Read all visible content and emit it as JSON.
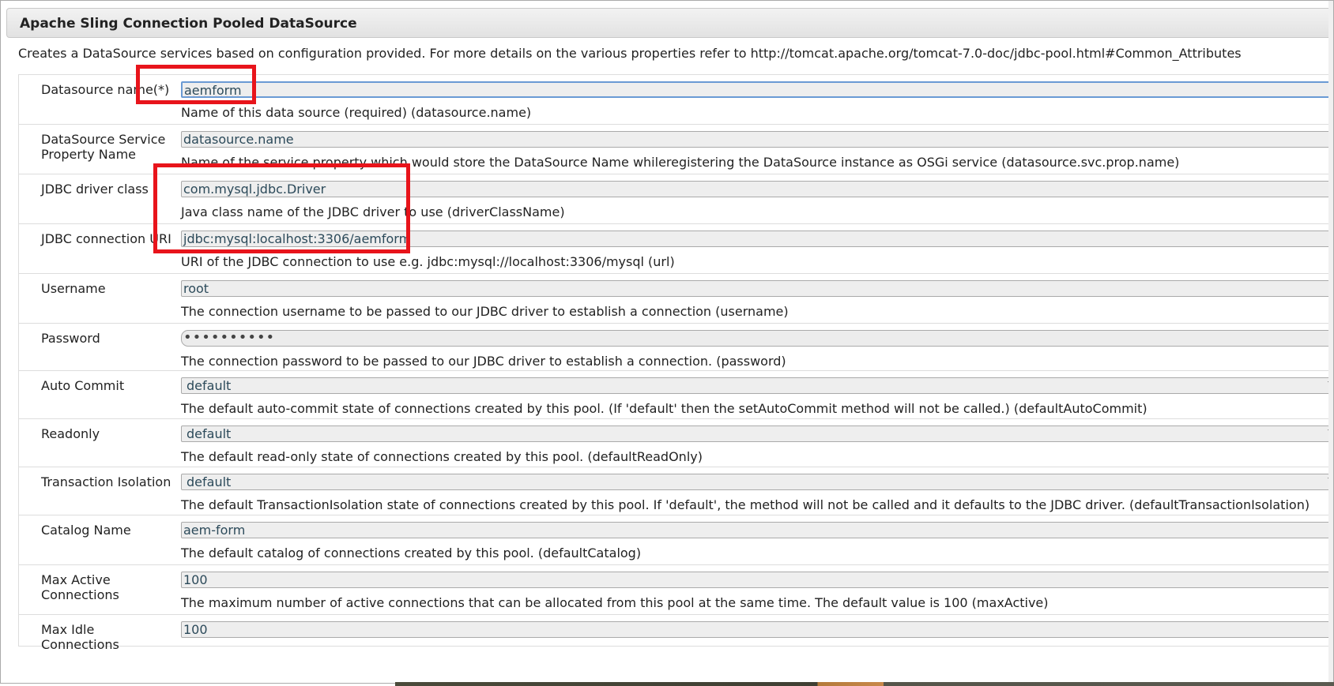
{
  "dialog": {
    "title": "Apache Sling Connection Pooled DataSource",
    "description": "Creates a DataSource services based on configuration provided. For more details on the various properties refer to http://tomcat.apache.org/tomcat-7.0-doc/jdbc-pool.html#Common_Attributes"
  },
  "fields": [
    {
      "label": "Datasource name(*)",
      "value": "aemform",
      "help": "Name of this data source (required) (datasource.name)",
      "type": "text",
      "focused": true
    },
    {
      "label": "DataSource Service Property Name",
      "value": "datasource.name",
      "help": "Name of the service property which would store the DataSource Name whileregistering the DataSource instance as OSGi service (datasource.svc.prop.name)",
      "type": "text"
    },
    {
      "label": "JDBC driver class",
      "value": "com.mysql.jdbc.Driver",
      "help": "Java class name of the JDBC driver to use (driverClassName)",
      "type": "text"
    },
    {
      "label": "JDBC connection URI",
      "value": "jdbc:mysql:localhost:3306/aemform",
      "help": "URI of the JDBC connection to use e.g. jdbc:mysql://localhost:3306/mysql (url)",
      "type": "text"
    },
    {
      "label": "Username",
      "value": "root",
      "help": "The connection username to be passed to our JDBC driver to establish a connection (username)",
      "type": "text"
    },
    {
      "label": "Password",
      "value": "••••••••••",
      "help": "The connection password to be passed to our JDBC driver to establish a connection. (password)",
      "type": "password"
    },
    {
      "label": "Auto Commit",
      "value": "default",
      "help": "The default auto-commit state of connections created by this pool. (If 'default' then the setAutoCommit method will not be called.) (defaultAutoCommit)",
      "type": "select"
    },
    {
      "label": "Readonly",
      "value": "default",
      "help": "The default read-only state of connections created by this pool. (defaultReadOnly)",
      "type": "select"
    },
    {
      "label": "Transaction Isolation",
      "value": "default",
      "help": "The default TransactionIsolation state of connections created by this pool. If 'default', the method will not be called and it defaults to the JDBC driver. (defaultTransactionIsolation)",
      "type": "select"
    },
    {
      "label": "Catalog Name",
      "value": "aem-form",
      "help": "The default catalog of connections created by this pool. (defaultCatalog)",
      "type": "text"
    },
    {
      "label": "Max Active Connections",
      "value": "100",
      "help": "The maximum number of active connections that can be allocated from this pool at the same time. The default value is 100 (maxActive)",
      "type": "text"
    },
    {
      "label": "Max Idle Connections",
      "value": "100",
      "help": "",
      "type": "text"
    }
  ],
  "icons": {
    "resize": "resize-grip-icon",
    "dropdown": "dropdown-arrow-icon"
  },
  "colors": {
    "highlight_box": "#e8141b",
    "focus_border": "#6a9ad4"
  }
}
